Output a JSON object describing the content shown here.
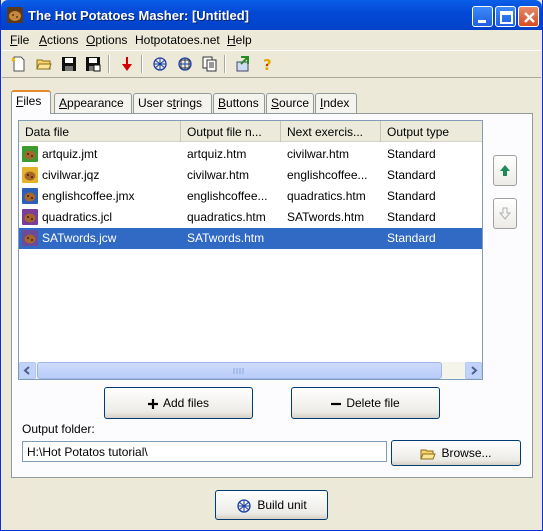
{
  "window": {
    "title": "The Hot Potatoes Masher: [Untitled]"
  },
  "menu": [
    {
      "label": "File",
      "key": "F",
      "rest": "ile"
    },
    {
      "label": "Actions",
      "key": "A",
      "rest": "ctions"
    },
    {
      "label": "Options",
      "key": "O",
      "rest": "ptions"
    },
    {
      "label": "Hotpotatoes.net",
      "key": "",
      "rest": "Hotpotatoes.net"
    },
    {
      "label": "Help",
      "key": "H",
      "rest": "elp"
    }
  ],
  "toolbar_icons": [
    "new-document-icon",
    "open-folder-icon",
    "save-icon",
    "save-as-icon",
    "arrow-down-icon",
    "web-icon",
    "web-unit-icon",
    "copy-pages-icon",
    "upload-icon",
    "help-icon"
  ],
  "tabs": [
    {
      "label": "Files",
      "active": true
    },
    {
      "label": "Appearance",
      "active": false
    },
    {
      "label": "User strings",
      "active": false
    },
    {
      "label": "Buttons",
      "active": false
    },
    {
      "label": "Source",
      "active": false
    },
    {
      "label": "Index",
      "active": false
    }
  ],
  "table": {
    "columns": [
      "Data file",
      "Output file n...",
      "Next exercis...",
      "Output type"
    ],
    "rows": [
      {
        "data_file": "artquiz.jmt",
        "output_file": "artquiz.htm",
        "next": "civilwar.htm",
        "type": "Standard",
        "icon_color": "#3c9a2e"
      },
      {
        "data_file": "civilwar.jqz",
        "output_file": "civilwar.htm",
        "next": "englishcoffee...",
        "type": "Standard",
        "icon_color": "#e3b22b"
      },
      {
        "data_file": "englishcoffee.jmx",
        "output_file": "englishcoffee...",
        "next": "quadratics.htm",
        "type": "Standard",
        "icon_color": "#2c5fb8"
      },
      {
        "data_file": "quadratics.jcl",
        "output_file": "quadratics.htm",
        "next": "SATwords.htm",
        "type": "Standard",
        "icon_color": "#7a3d9a"
      },
      {
        "data_file": "SATwords.jcw",
        "output_file": "SATwords.htm",
        "next": "",
        "type": "Standard",
        "icon_color": "#6a4a9a",
        "selected": true
      }
    ]
  },
  "buttons": {
    "add_files": "Add files",
    "delete_file": "Delete file",
    "browse": "Browse...",
    "build_unit": "Build unit"
  },
  "output_folder": {
    "label": "Output folder:",
    "value": "H:\\Hot Potatos tutorial\\"
  }
}
